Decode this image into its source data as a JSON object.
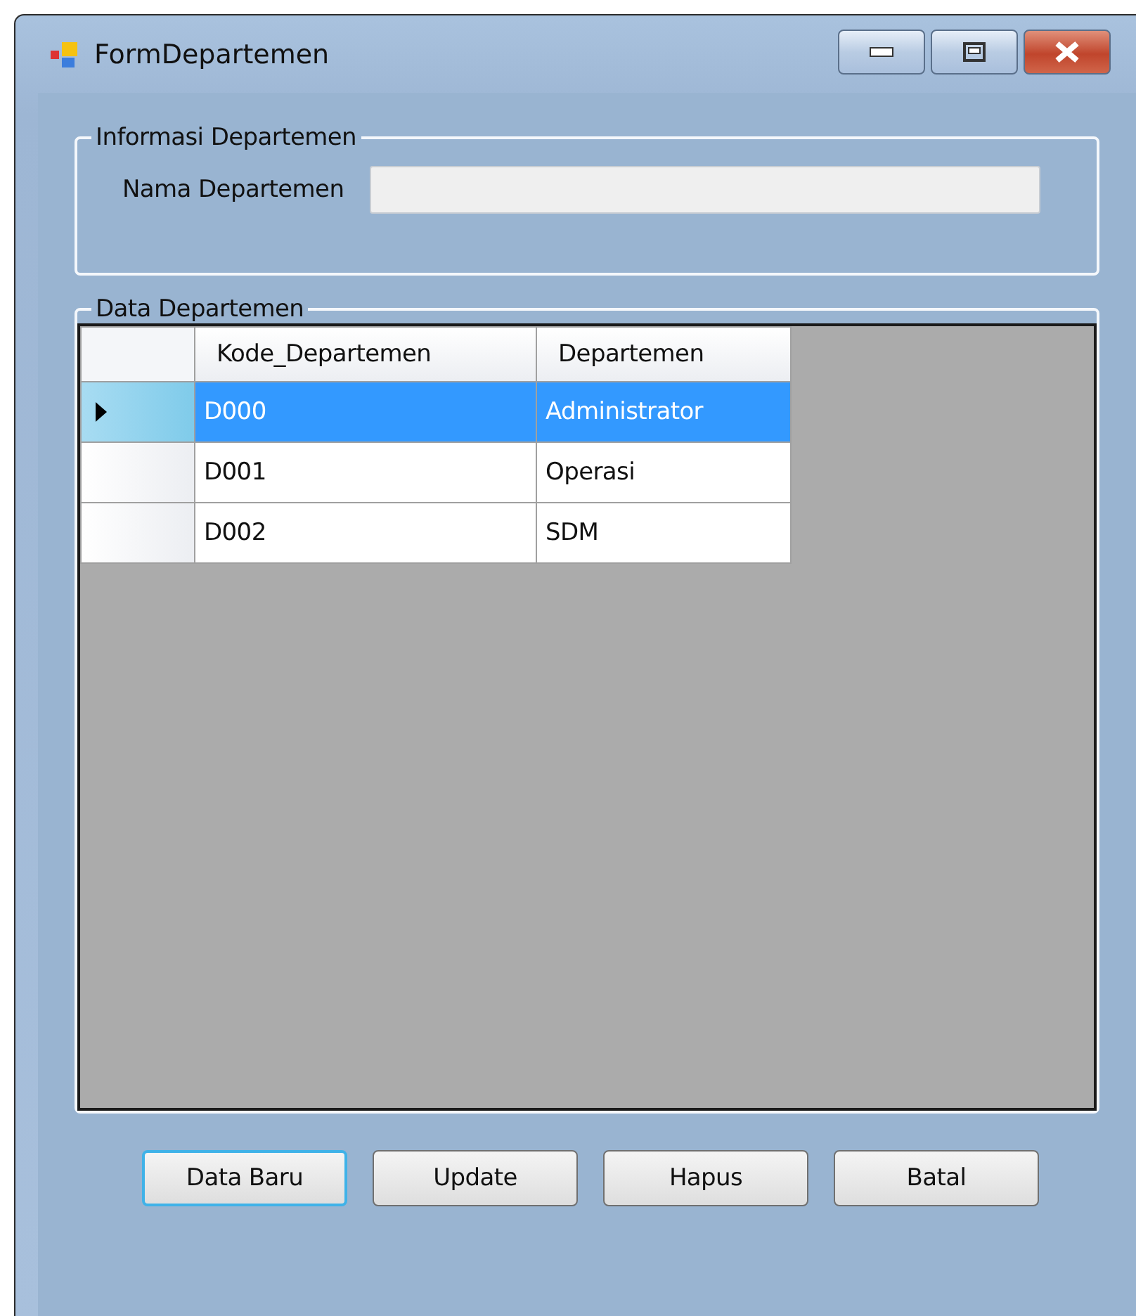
{
  "window": {
    "title": "FormDepartemen"
  },
  "info_group": {
    "title": "Informasi Departemen",
    "field": {
      "label": "Nama Departemen"
    }
  },
  "data_group": {
    "title": "Data Departemen",
    "columns": [
      "Kode_Departemen",
      "Departemen"
    ],
    "rows": [
      {
        "cells": [
          "D000",
          "Administrator"
        ],
        "selected": true
      },
      {
        "cells": [
          "D001",
          "Operasi"
        ],
        "selected": false
      },
      {
        "cells": [
          "D002",
          "SDM"
        ],
        "selected": false
      }
    ]
  },
  "buttons": [
    {
      "label": "Data Baru",
      "focused": true
    },
    {
      "label": "Update",
      "focused": false
    },
    {
      "label": "Hapus",
      "focused": false
    },
    {
      "label": "Batal",
      "focused": false
    }
  ]
}
